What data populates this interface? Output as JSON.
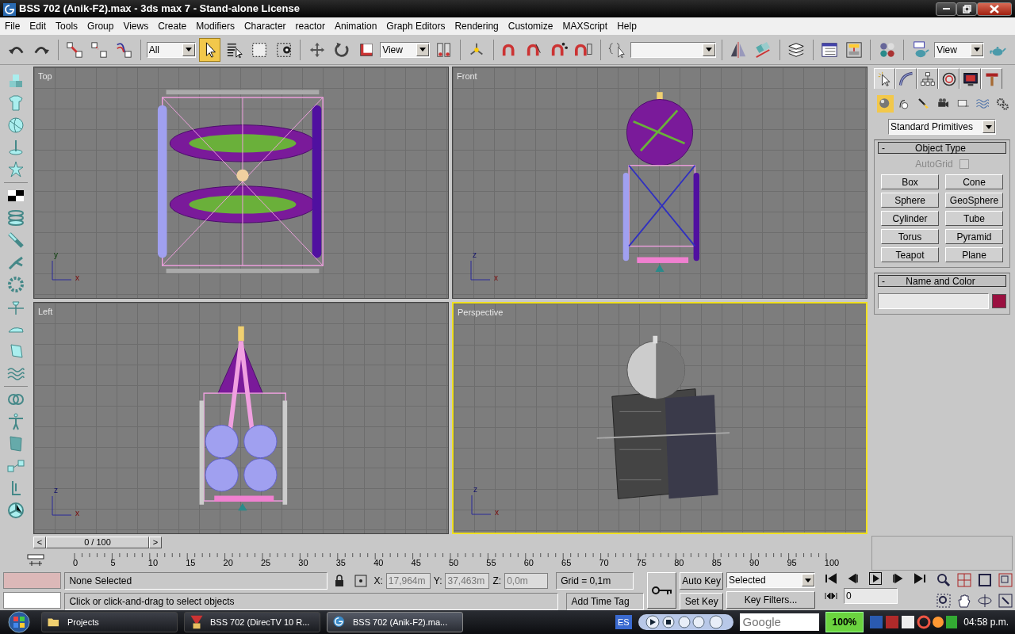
{
  "window": {
    "title": "BSS 702 (Anik-F2).max - 3ds max 7  - Stand-alone License"
  },
  "menu": [
    "File",
    "Edit",
    "Tools",
    "Group",
    "Views",
    "Create",
    "Modifiers",
    "Character",
    "reactor",
    "Animation",
    "Graph Editors",
    "Rendering",
    "Customize",
    "MAXScript",
    "Help"
  ],
  "toolbar": [
    {
      "kind": "undo",
      "selected": false
    },
    {
      "kind": "redo",
      "selected": false
    },
    {
      "kind": "sep"
    },
    {
      "kind": "link",
      "selected": false
    },
    {
      "kind": "unlink",
      "selected": false
    },
    {
      "kind": "bind",
      "selected": false
    },
    {
      "kind": "sep"
    },
    {
      "kind": "dropdown",
      "value": "All"
    },
    {
      "kind": "select",
      "selected": true
    },
    {
      "kind": "selectname",
      "selected": false
    },
    {
      "kind": "region",
      "selected": false
    },
    {
      "kind": "window",
      "selected": false
    },
    {
      "kind": "sep"
    },
    {
      "kind": "move",
      "selected": false
    },
    {
      "kind": "rotate",
      "selected": false
    },
    {
      "kind": "scale",
      "selected": false
    },
    {
      "kind": "dropdown",
      "value": "View"
    },
    {
      "kind": "pivot",
      "selected": false
    },
    {
      "kind": "sep"
    },
    {
      "kind": "manipulate",
      "selected": false
    },
    {
      "kind": "sep"
    },
    {
      "kind": "snap",
      "selected": false
    },
    {
      "kind": "anglesnap",
      "selected": false
    },
    {
      "kind": "percentsnap",
      "selected": false
    },
    {
      "kind": "spinnersnap",
      "selected": false
    },
    {
      "kind": "sep"
    },
    {
      "kind": "namedsel",
      "selected": false
    },
    {
      "kind": "dropdown"
    },
    {
      "kind": "sep"
    },
    {
      "kind": "mirror",
      "selected": false
    },
    {
      "kind": "align",
      "selected": false
    },
    {
      "kind": "sep"
    },
    {
      "kind": "layers",
      "selected": false
    },
    {
      "kind": "sep"
    },
    {
      "kind": "curves",
      "selected": false
    },
    {
      "kind": "schematic",
      "selected": false
    },
    {
      "kind": "sep"
    },
    {
      "kind": "material",
      "selected": false
    },
    {
      "kind": "sep"
    },
    {
      "kind": "rendersetup",
      "selected": false
    },
    {
      "kind": "dropdown",
      "value": "View"
    },
    {
      "kind": "teapot",
      "selected": false
    }
  ],
  "viewports": [
    {
      "label": "Top",
      "active": false,
      "axes": [
        "y",
        "x"
      ]
    },
    {
      "label": "Front",
      "active": false,
      "axes": [
        "z",
        "x"
      ]
    },
    {
      "label": "Left",
      "active": false,
      "axes": [
        "z",
        "x"
      ]
    },
    {
      "label": "Perspective",
      "active": true,
      "axes": [
        "z",
        "x"
      ]
    }
  ],
  "command_panel": {
    "tabs": [
      {
        "kind": "create",
        "selected": true
      },
      {
        "kind": "modify",
        "selected": false
      },
      {
        "kind": "hierarchy",
        "selected": false
      },
      {
        "kind": "motion",
        "selected": false
      },
      {
        "kind": "display",
        "selected": false
      },
      {
        "kind": "utilities",
        "selected": false
      }
    ],
    "categories": [
      {
        "kind": "geometry",
        "selected": true
      },
      {
        "kind": "shapes",
        "selected": false
      },
      {
        "kind": "lights",
        "selected": false
      },
      {
        "kind": "cameras",
        "selected": false
      },
      {
        "kind": "helpers",
        "selected": false
      },
      {
        "kind": "spacewarps",
        "selected": false
      },
      {
        "kind": "systems",
        "selected": false
      }
    ],
    "category_dropdown": "Standard Primitives",
    "object_type": {
      "title": "Object Type",
      "collapse": "-",
      "autogrid": {
        "label": "AutoGrid",
        "checked": false,
        "disabled": true
      },
      "buttons": [
        "Box",
        "Cone",
        "Sphere",
        "GeoSphere",
        "Cylinder",
        "Tube",
        "Torus",
        "Pyramid",
        "Teapot",
        "Plane"
      ]
    },
    "name_and_color": {
      "title": "Name and Color",
      "collapse": "-"
    }
  },
  "time_slider": {
    "prev": "<",
    "position": "0 / 100",
    "next": ">"
  },
  "track_bar": {
    "labels": [
      "0",
      "5",
      "10",
      "15",
      "20",
      "25",
      "30",
      "35",
      "40",
      "45",
      "50",
      "55",
      "60",
      "65",
      "70",
      "75",
      "80",
      "85",
      "90",
      "95",
      "100"
    ]
  },
  "status": {
    "selection": "None Selected",
    "prompt": "Click or click-and-drag to select objects",
    "x_label": "X:",
    "x": "17,964m",
    "y_label": "Y:",
    "y": "37,463m",
    "z_label": "Z:",
    "z": "0,0m",
    "grid": "Grid = 0,1m",
    "time_tag": "Add Time Tag",
    "auto_key": "Auto Key",
    "set_key": "Set Key",
    "key_mode": "Selected",
    "key_filters": "Key Filters...",
    "frame": "0"
  },
  "taskbar": {
    "tasks": [
      {
        "label": "Projects",
        "kind": "folder",
        "selected": false
      },
      {
        "label": "BSS 702 (DirecTV 10 R...",
        "kind": "paint",
        "selected": false
      },
      {
        "label": "BSS 702 (Anik-F2).ma...",
        "kind": "max",
        "selected": true
      }
    ],
    "language": "ES",
    "search_placeholder": "Google",
    "battery": "100%",
    "clock": "04:58 p.m."
  }
}
